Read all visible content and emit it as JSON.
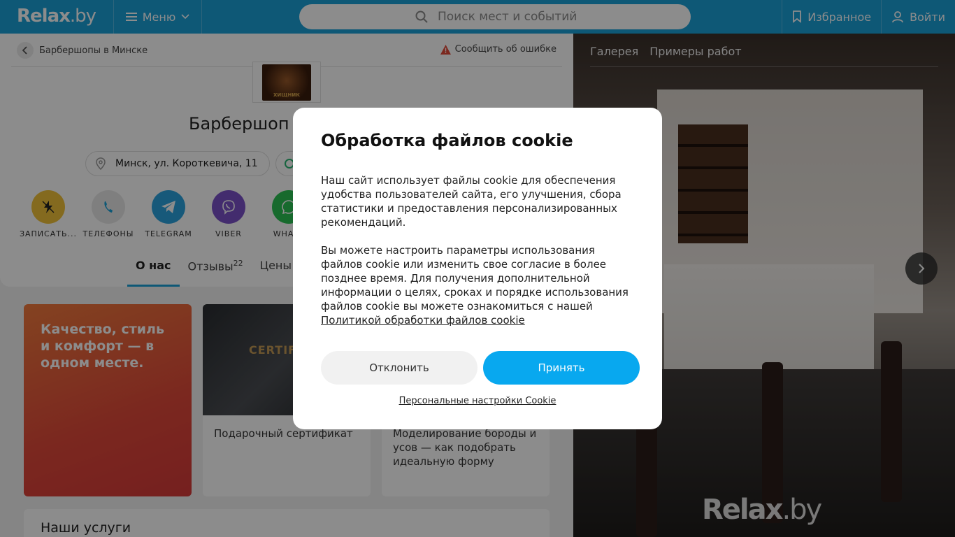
{
  "header": {
    "logo_main": "Relax",
    "logo_suffix": ".by",
    "menu_label": "Меню",
    "search_placeholder": "Поиск мест и событий",
    "favorites_label": "Избранное",
    "login_label": "Войти",
    "brand_color": "#1ba0d8"
  },
  "page": {
    "breadcrumb": "Барбершопы в Минске",
    "report_error": "Сообщить об ошибке",
    "title": "Барбершоп",
    "address": "Минск, ул. Короткевича, 11",
    "logo_text": "ХИЩНИК",
    "actions": [
      {
        "label": "ЗАПИСАТЬ...",
        "icon": "lightning-icon",
        "color": "#f0c23a"
      },
      {
        "label": "ТЕЛЕФОНЫ",
        "icon": "phone-icon",
        "color": "#e8e8e8"
      },
      {
        "label": "TELEGRAM",
        "icon": "telegram-icon",
        "color": "#2aa3de"
      },
      {
        "label": "VIBER",
        "icon": "viber-icon",
        "color": "#7a51c8"
      },
      {
        "label": "WHATS",
        "icon": "whatsapp-icon",
        "color": "#2bc253"
      }
    ],
    "tabs": [
      {
        "label": "О нас",
        "badge": ""
      },
      {
        "label": "Отзывы",
        "badge": "22"
      },
      {
        "label": "Цены",
        "badge": ""
      }
    ],
    "promo_text": "Качество, стиль и комфорт — в одном месте.",
    "news": [
      {
        "caption": "Подарочный сертификат",
        "image_text": "CERTIF"
      },
      {
        "caption": "Моделирование бороды и усов — как подобрать идеальную форму"
      }
    ],
    "services_title": "Наши услуги"
  },
  "gallery": {
    "tabs": [
      "Галерея",
      "Примеры работ"
    ],
    "watermark_main": "Relax",
    "watermark_suffix": ".by"
  },
  "cookie_modal": {
    "title": "Обработка файлов cookie",
    "paragraph1": "Наш сайт использует файлы cookie для обеспечения удобства пользователей сайта, его улучшения, сбора статистики и предоставления персонализированных рекомендаций.",
    "paragraph2": "Вы можете настроить параметры использования файлов cookie или изменить свое согласие в более позднее время. Для получения дополнительной информации о целях, сроках и порядке использования файлов cookie вы можете ознакомиться с нашей",
    "policy_link": "Политикой обработки файлов cookie",
    "decline_label": "Отклонить",
    "accept_label": "Принять",
    "personal_settings": "Персональные настройки Cookie",
    "accept_color": "#08a8ef"
  }
}
